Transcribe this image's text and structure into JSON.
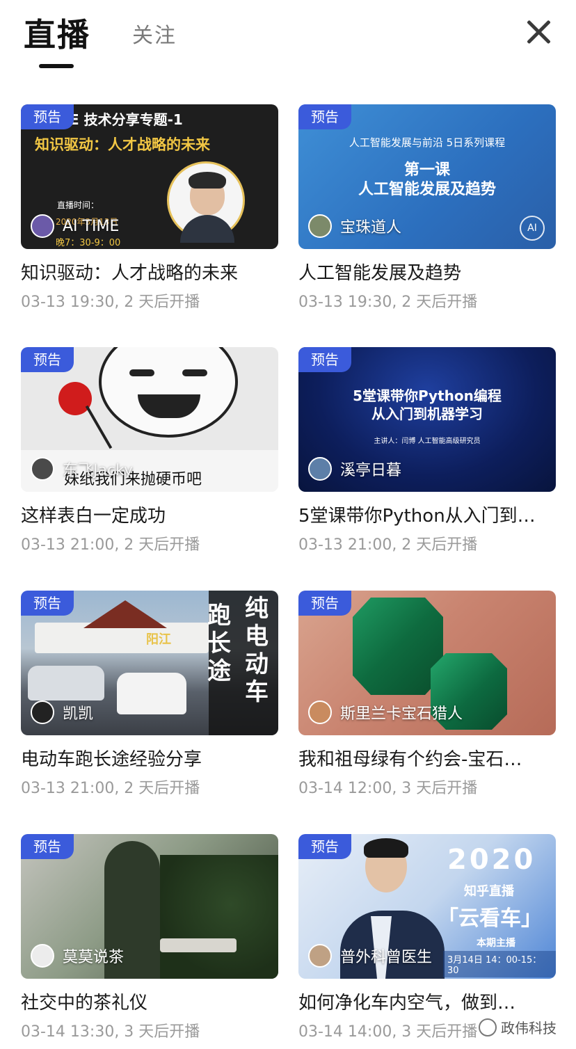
{
  "header": {
    "tab_live": "直播",
    "tab_follow": "关注"
  },
  "cards": [
    {
      "badge": "预告",
      "overlay_lines": [
        "E  技术分享专题-1",
        "知识驱动：人才战略的未来",
        "直播时间：",
        "2020年3月13日",
        "晚7：30-9：00"
      ],
      "host": "AI TIME",
      "title": "知识驱动：人才战略的未来",
      "time": "03-13 19:30, 2 天后开播"
    },
    {
      "badge": "预告",
      "overlay_lines": [
        "人工智能发展与前沿  5日系列课程",
        "第一课",
        "人工智能发展及趋势"
      ],
      "host": "宝珠道人",
      "title": "人工智能发展及趋势",
      "time": "03-13 19:30, 2 天后开播"
    },
    {
      "badge": "预告",
      "overlay_lines": [
        "妹纸我们来抛硬币吧"
      ],
      "host": "东飞Jacky",
      "title": "这样表白一定成功",
      "time": "03-13 21:00, 2 天后开播"
    },
    {
      "badge": "预告",
      "overlay_lines": [
        "5堂课带你Python编程",
        "从入门到机器学习",
        "主讲人：闫博  人工智能高级研究员"
      ],
      "host": "溪亭日暮",
      "title": "5堂课带你Python从入门到…",
      "time": "03-13 21:00, 2 天后开播"
    },
    {
      "badge": "预告",
      "overlay_lines": [
        "跑长途",
        "纯电动车",
        "阳江"
      ],
      "host": "凯凯",
      "title": "电动车跑长途经验分享",
      "time": "03-13 21:00, 2 天后开播"
    },
    {
      "badge": "预告",
      "overlay_lines": [],
      "host": "斯里兰卡宝石猎人",
      "title": "我和祖母绿有个约会-宝石…",
      "time": "03-14 12:00, 3 天后开播"
    },
    {
      "badge": "预告",
      "overlay_lines": [],
      "host": "莫莫说茶",
      "title": "社交中的茶礼仪",
      "time": "03-14 13:30, 3 天后开播"
    },
    {
      "badge": "预告",
      "overlay_lines": [
        "2020",
        "知乎直播",
        "「云看车」",
        "本期主播",
        "3月14日  14：00-15：30"
      ],
      "host": "普外科曾医生",
      "title": "如何净化车内空气，做到…",
      "time": "03-14 14:00, 3 天后开播"
    }
  ],
  "watermark": "政伟科技",
  "colors": {
    "badge": "#3b5bdb",
    "title_text": "#1a1a1a",
    "time_text": "#9a9a9a"
  }
}
